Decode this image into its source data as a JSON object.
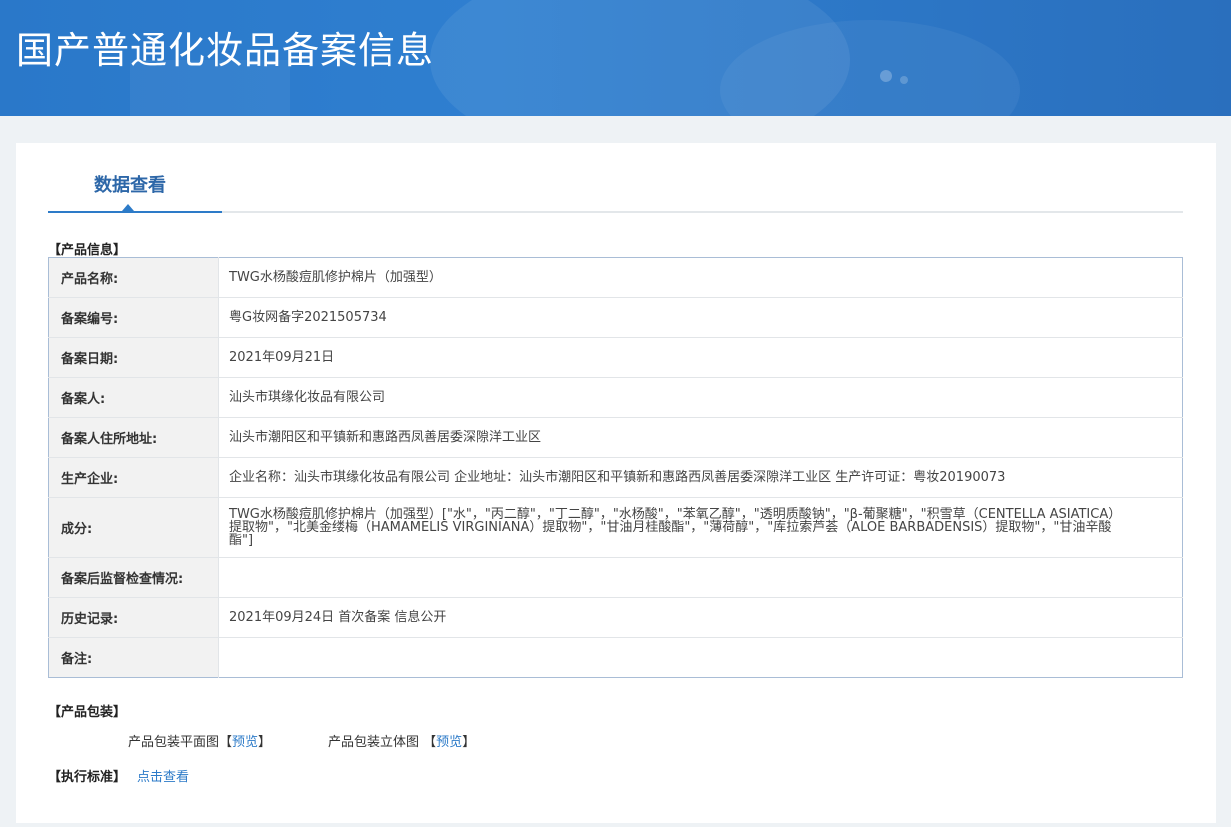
{
  "header": {
    "title": "国产普通化妆品备案信息"
  },
  "tabs": [
    {
      "label": "数据查看"
    }
  ],
  "product_section": {
    "label": "【产品信息】"
  },
  "fields": [
    {
      "key": "产品名称:",
      "value": "TWG水杨酸痘肌修护棉片（加强型）"
    },
    {
      "key": "备案编号:",
      "value": "粤G妆网备字2021505734"
    },
    {
      "key": "备案日期:",
      "value": "2021年09月21日"
    },
    {
      "key": "备案人:",
      "value": "汕头市琪缘化妆品有限公司"
    },
    {
      "key": "备案人住所地址:",
      "value": "汕头市潮阳区和平镇新和惠路西凤善居委深隙洋工业区"
    },
    {
      "key": "生产企业:",
      "value": "企业名称：汕头市琪缘化妆品有限公司 企业地址：汕头市潮阳区和平镇新和惠路西凤善居委深隙洋工业区 生产许可证：粤妆20190073"
    },
    {
      "key": "成分:",
      "value": "TWG水杨酸痘肌修护棉片（加强型）[\"水\"，\"丙二醇\"，\"丁二醇\"，\"水杨酸\"，\"苯氧乙醇\"，\"透明质酸钠\"，\"β-葡聚糖\"，\"积雪草（CENTELLA ASIATICA）提取物\"，\"北美金缕梅（HAMAMELIS VIRGINIANA）提取物\"，\"甘油月桂酸酯\"，\"薄荷醇\"，\"库拉索芦荟（ALOE BARBADENSIS）提取物\"，\"甘油辛酸酯\"]"
    },
    {
      "key": "备案后监督检查情况:",
      "value": ""
    },
    {
      "key": "历史记录:",
      "value": "2021年09月24日 首次备案 信息公开"
    },
    {
      "key": "备注:",
      "value": ""
    }
  ],
  "packaging": {
    "label": "【产品包装】",
    "flat_label": "产品包装平面图",
    "flat_open": "【",
    "flat_link": "预览",
    "flat_close": "】",
    "stereo_label": "产品包装立体图",
    "stereo_open": "【",
    "stereo_link": "预览",
    "stereo_close": "】"
  },
  "standard": {
    "label": "【执行标准】",
    "link": "点击查看"
  }
}
